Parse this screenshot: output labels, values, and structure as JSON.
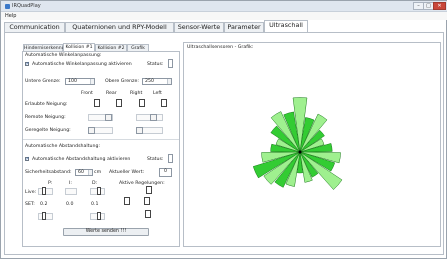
{
  "window": {
    "title": "IRQuadPlay"
  },
  "menu": {
    "help": "Help"
  },
  "main_tabs": [
    {
      "label": "Communication"
    },
    {
      "label": "Quaternionen und RPY-Modell"
    },
    {
      "label": "Sensor-Werte"
    },
    {
      "label": "Parameter"
    },
    {
      "label": "Ultraschall"
    }
  ],
  "sub_tabs": [
    {
      "label": "Hinderniserkennung"
    },
    {
      "label": "Kollision #1"
    },
    {
      "label": "Kollision #2"
    },
    {
      "label": "Grafik"
    }
  ],
  "tilt": {
    "header": "Automatische Winkelanpassung:",
    "auto_label": "Automatische Winkelanpassung aktivieren",
    "status_label": "Status:",
    "lower_label": "Untere Grenze:",
    "lower_value": "100",
    "upper_label": "Obere Grenze:",
    "upper_value": "250",
    "col_front": "Front",
    "col_rear": "Rear",
    "col_right": "Right",
    "col_left": "Left",
    "allowed_label": "Erlaubte Neigung:",
    "remote_label": "Remote Neigung:",
    "regulated_label": "Geregelte Neigung:"
  },
  "distance": {
    "header": "Automatische Abstandshaltung:",
    "auto_label": "Automatische Abstandshaltung aktivieren",
    "status_label": "Status:",
    "safety_label": "Sicherheitsabstand:",
    "safety_value": "60",
    "safety_unit": "cm",
    "current_label": "Aktueller Wert:",
    "current_value": "0",
    "p_label": "P:",
    "i_label": "I:",
    "d_label": "D:",
    "live_label": "Live:",
    "set_label": "SET:",
    "set_p": "0.2",
    "set_i": "0.0",
    "set_d": "0.1",
    "active_label": "Aktive Regelungen:"
  },
  "send_button": "Werte senden !!!",
  "graph": {
    "title": "Ultraschallsensoren - Grafik:",
    "sectors": [
      0.78,
      0.5,
      0.6,
      0.42,
      0.36,
      0.46,
      0.58,
      0.52,
      0.72,
      0.4,
      0.44,
      0.3,
      0.5,
      0.56,
      0.62,
      0.7,
      0.55,
      0.42,
      0.36,
      0.5,
      0.64,
      0.58
    ],
    "colors": {
      "light": "#9ff08f",
      "dark": "#33cc33",
      "outline": "#1a7a1a"
    }
  }
}
